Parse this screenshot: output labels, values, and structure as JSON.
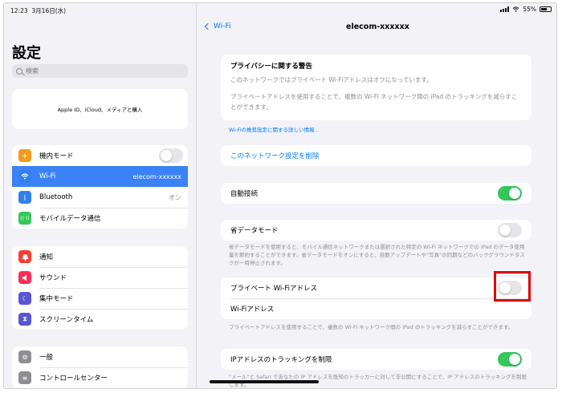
{
  "status": {
    "time": "12:23",
    "date": "3月16日(水)",
    "battery": "55%"
  },
  "sidebar": {
    "title": "設定",
    "search_placeholder": "検索",
    "appleid_text": "Apple ID、iCloud、メディアと購入",
    "group1": [
      {
        "label": "機内モード",
        "icon": "airplane-icon",
        "color": "#f29b1d",
        "glyph": "✈",
        "control": "toggle-off"
      },
      {
        "label": "Wi-Fi",
        "icon": "wifi-icon",
        "color": "#2f80ed",
        "glyph": "◠",
        "value": "elecom-xxxxxx",
        "selected": true
      },
      {
        "label": "Bluetooth",
        "icon": "bluetooth-icon",
        "color": "#2f80ed",
        "glyph": "ᛒ",
        "value": "オン"
      },
      {
        "label": "モバイルデータ通信",
        "icon": "antenna-icon",
        "color": "#34c759",
        "glyph": "((·))"
      }
    ],
    "group2": [
      {
        "label": "通知",
        "icon": "bell-icon",
        "color": "#ff3b30",
        "glyph": "▲"
      },
      {
        "label": "サウンド",
        "icon": "speaker-icon",
        "color": "#ff2d55",
        "glyph": "◀"
      },
      {
        "label": "集中モード",
        "icon": "moon-icon",
        "color": "#5856d6",
        "glyph": "☾"
      },
      {
        "label": "スクリーンタイム",
        "icon": "hourglass-icon",
        "color": "#5856d6",
        "glyph": "⧗"
      }
    ],
    "group3": [
      {
        "label": "一般",
        "icon": "gear-icon",
        "color": "#8e8e93",
        "glyph": "⚙"
      },
      {
        "label": "コントロールセンター",
        "icon": "switches-icon",
        "color": "#8e8e93",
        "glyph": "≡"
      }
    ]
  },
  "detail": {
    "back_label": "Wi-Fi",
    "title": "elecom-xxxxxx",
    "privacy_title": "プライバシーに関する警告",
    "privacy_text1": "このネットワークではプライベート Wi-Fiアドレスはオフになっています。",
    "privacy_text2": "プライベートアドレスを使用することで、複数の Wi-Fi ネットワーク間の iPad のトラッキングを減らすことができます。",
    "info_link": "Wi-Fiの推奨設定に関する詳しい情報...",
    "forget_label": "このネットワーク設定を削除",
    "auto_join_label": "自動接続",
    "low_data_label": "省データモード",
    "low_data_note": "省データモードを使用すると、モバイル通信ネットワークまたは選択された特定の Wi-Fi ネットワークでの iPad のデータ使用量を節約することができます。省データモードをオンにすると、自動アップデートや\"写真\"の同期などのバックグラウンドタスクが一時停止されます。",
    "private_addr_label": "プライベート Wi-Fiアドレス",
    "wifi_addr_label": "Wi-Fiアドレス",
    "private_addr_note": "プライベートアドレスを使用することで、複数の Wi-Fi ネットワーク間の iPad のトラッキングを減らすことができます。",
    "ip_tracking_label": "IPアドレスのトラッキングを制限",
    "ip_tracking_note": "\"メール\"と Safari であなたの IP アドレスを既知のトラッカーに対して非公開にすることで、IP アドレスのトラッキングを制限します。"
  }
}
